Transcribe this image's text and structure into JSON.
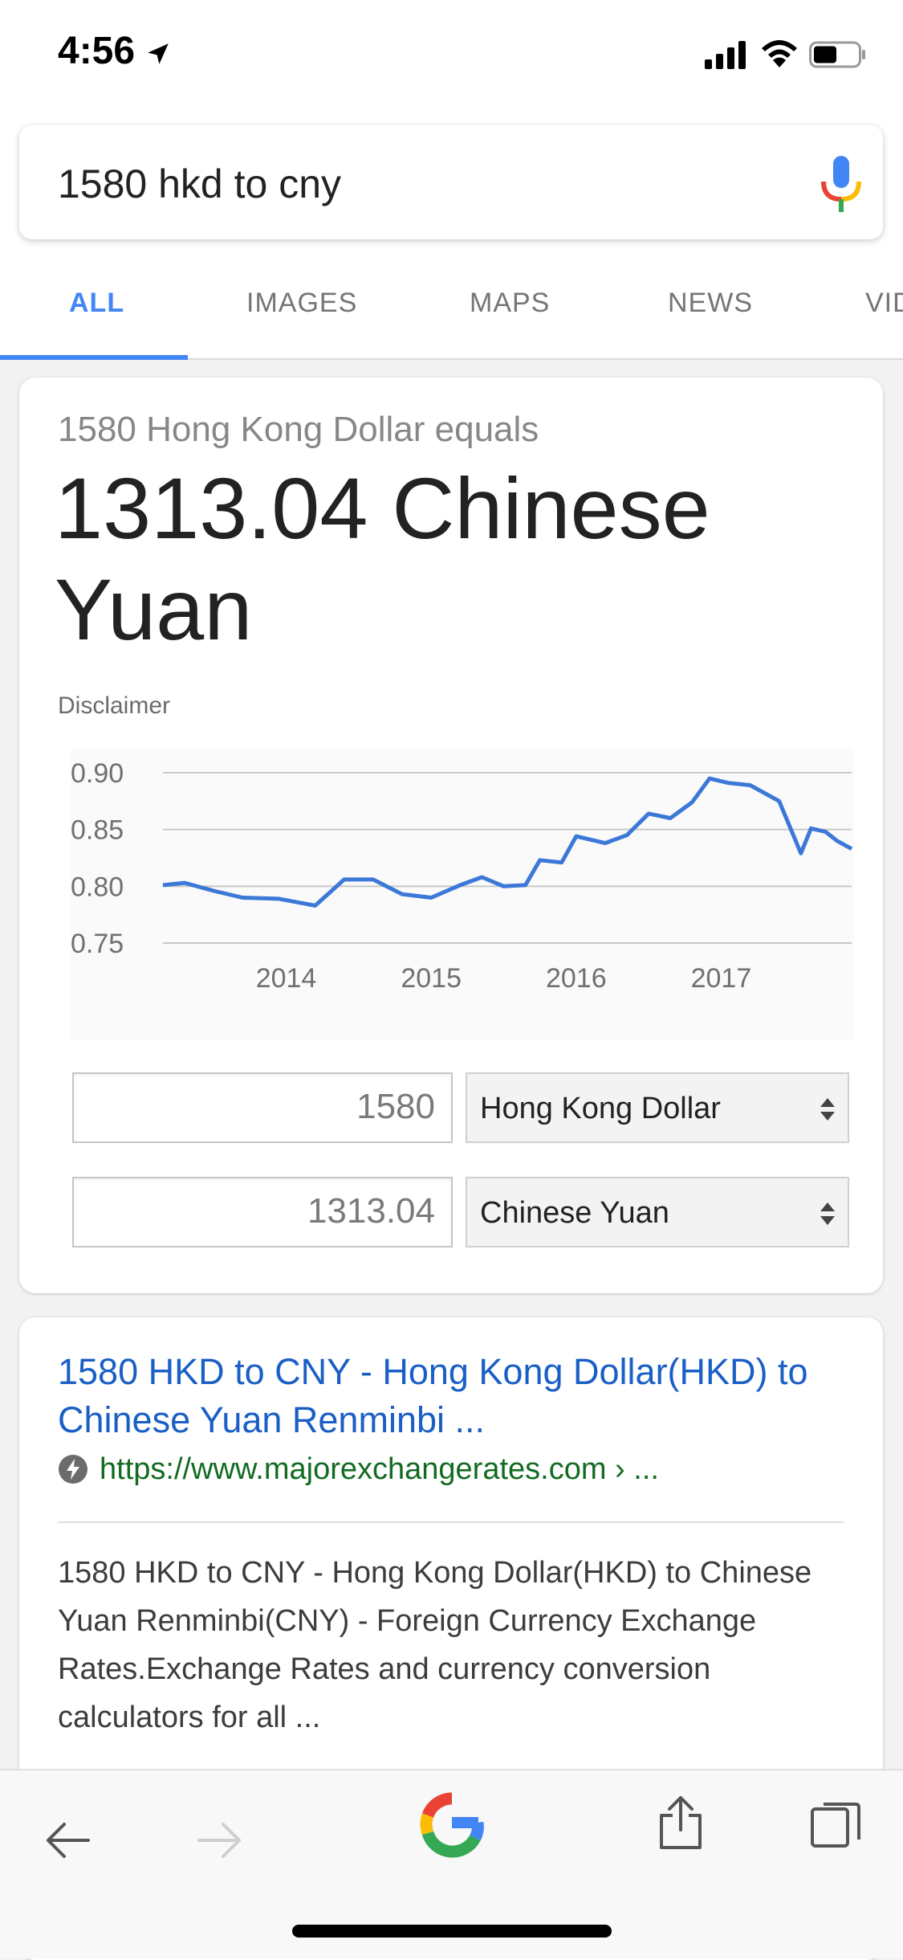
{
  "status_bar": {
    "time": "4:56"
  },
  "search": {
    "query": "1580 hkd to cny"
  },
  "tabs": [
    {
      "label": "ALL",
      "active": true
    },
    {
      "label": "IMAGES"
    },
    {
      "label": "MAPS"
    },
    {
      "label": "NEWS"
    },
    {
      "label": "VID"
    }
  ],
  "converter": {
    "equals_line": "1580 Hong Kong Dollar equals",
    "result_line": "1313.04 Chinese Yuan",
    "disclaimer": "Disclaimer",
    "from_amount": "1580",
    "from_currency": "Hong Kong Dollar",
    "to_amount": "1313.04",
    "to_currency": "Chinese Yuan"
  },
  "chart_data": {
    "type": "line",
    "title": "",
    "xlabel": "",
    "ylabel": "",
    "ylim": [
      0.75,
      0.9
    ],
    "yticks": [
      "0.90",
      "0.85",
      "0.80",
      "0.75"
    ],
    "xticks": [
      "2014",
      "2015",
      "2016",
      "2017"
    ],
    "grid": true,
    "color": "#3c78d8",
    "series": [
      {
        "x": [
          2013.15,
          2013.3,
          2013.5,
          2013.7,
          2013.95,
          2014.2,
          2014.4,
          2014.6,
          2014.8,
          2015.0,
          2015.2,
          2015.35,
          2015.5,
          2015.65,
          2015.75,
          2015.9,
          2016.0,
          2016.2,
          2016.35,
          2016.5,
          2016.65,
          2016.8,
          2016.92,
          2017.05,
          2017.2,
          2017.4,
          2017.55,
          2017.62,
          2017.72,
          2017.8,
          2017.9
        ],
        "y": [
          0.801,
          0.803,
          0.796,
          0.79,
          0.789,
          0.783,
          0.806,
          0.806,
          0.793,
          0.79,
          0.801,
          0.808,
          0.8,
          0.801,
          0.823,
          0.821,
          0.844,
          0.838,
          0.845,
          0.864,
          0.86,
          0.874,
          0.895,
          0.891,
          0.889,
          0.875,
          0.829,
          0.851,
          0.848,
          0.84,
          0.833
        ]
      }
    ]
  },
  "result": {
    "title": "1580 HKD to CNY - Hong Kong Dollar(HKD) to Chinese Yuan Renminbi ...",
    "url": "https://www.majorexchangerates.com › ...",
    "snippet": "1580 HKD to CNY - Hong Kong Dollar(HKD) to Chinese Yuan Renminbi(CNY) - Foreign Currency Exchange Rates.Exchange Rates and currency conversion calculators for all ..."
  }
}
